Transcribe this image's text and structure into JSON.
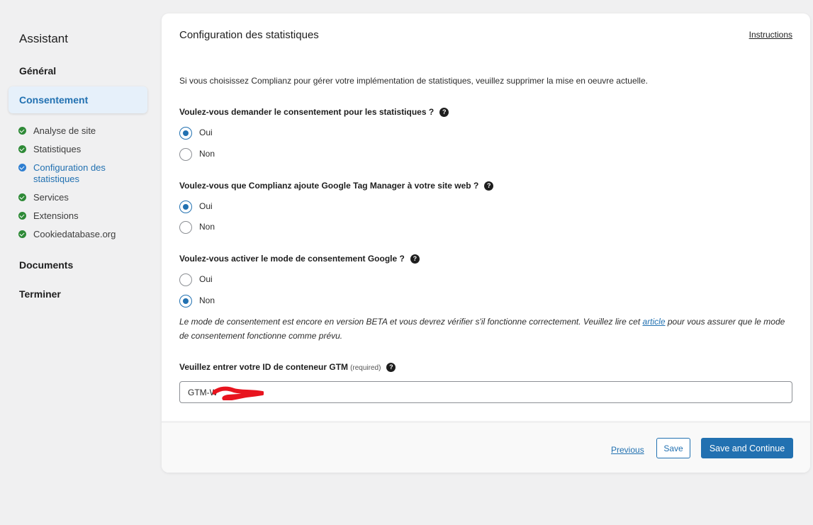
{
  "sidebar": {
    "title": "Assistant",
    "sections": {
      "general": "Général",
      "consent": "Consentement",
      "documents": "Documents",
      "finish": "Terminer"
    },
    "sub_items": [
      {
        "label": "Analyse de site",
        "status": "done"
      },
      {
        "label": "Statistiques",
        "status": "done"
      },
      {
        "label": "Configuration des statistiques",
        "status": "current"
      },
      {
        "label": "Services",
        "status": "done"
      },
      {
        "label": "Extensions",
        "status": "done"
      },
      {
        "label": "Cookiedatabase.org",
        "status": "done"
      }
    ]
  },
  "card": {
    "title": "Configuration des statistiques",
    "instructions_link": "Instructions",
    "intro": "Si vous choisissez Complianz pour gérer votre implémentation de statistiques, veuillez supprimer la mise en oeuvre actuelle.",
    "questions": [
      {
        "label": "Voulez-vous demander le consentement pour les statistiques ?",
        "options": [
          "Oui",
          "Non"
        ],
        "selected": "Oui"
      },
      {
        "label": "Voulez-vous que Complianz ajoute Google Tag Manager à votre site web ?",
        "options": [
          "Oui",
          "Non"
        ],
        "selected": "Oui"
      },
      {
        "label": "Voulez-vous activer le mode de consentement Google ?",
        "options": [
          "Oui",
          "Non"
        ],
        "selected": "Non"
      }
    ],
    "help_glyph": "?",
    "note_before": "Le mode de consentement est encore en version BETA et vous devrez vérifier s'il fonctionne correctement. Veuillez lire cet ",
    "note_link": "article",
    "note_after": " pour vous assurer que le mode de consentement fonctionne comme prévu.",
    "gtm_label": "Veuillez entrer votre ID de conteneur GTM",
    "gtm_required": "(required)",
    "gtm_value": "GTM-W"
  },
  "footer": {
    "previous": "Previous",
    "save": "Save",
    "save_continue": "Save and Continue"
  },
  "colors": {
    "accent": "#2271b1",
    "done": "#2e8a37",
    "redaction": "#e8141e"
  }
}
